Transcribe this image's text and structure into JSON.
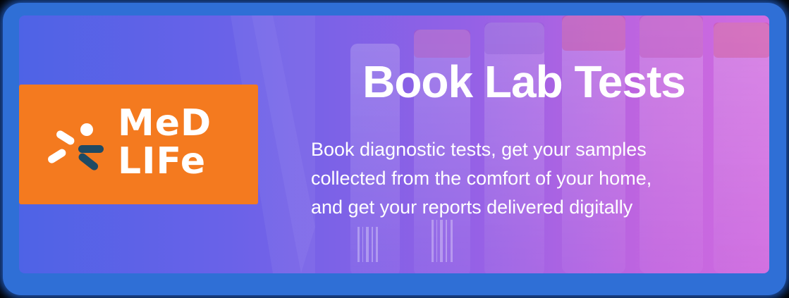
{
  "banner": {
    "headline": "Book Lab Tests",
    "description_lines": [
      "Book diagnostic tests, get your samples",
      "collected from the comfort of your home,",
      "and get your reports delivered digitally"
    ]
  },
  "logo": {
    "line1": "MeD",
    "line2": "LIFe",
    "tile_color": "#f47a1f",
    "mark_dark_color": "#1f4a63"
  },
  "colors": {
    "frame": "#2f6fd6",
    "gradient_start": "#4e63e6",
    "gradient_end": "#d06be0",
    "text": "#ffffff"
  },
  "icons": {
    "brand_mark": "medlife-figure-icon",
    "background": "test-tubes-image"
  }
}
